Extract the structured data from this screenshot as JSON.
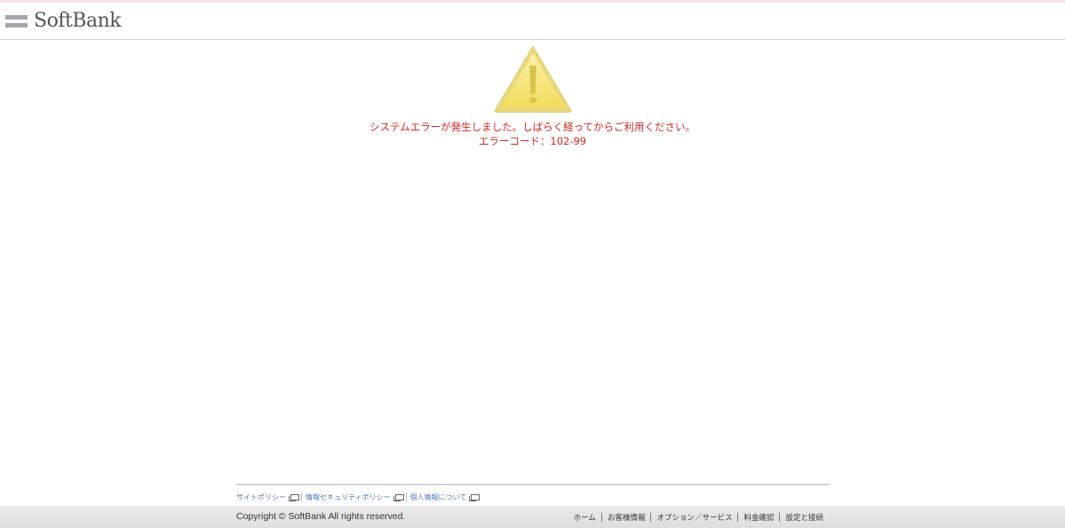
{
  "header": {
    "logo_text": "SoftBank"
  },
  "error": {
    "icon": "warning-triangle-icon",
    "message": "システムエラーが発生しました。しばらく経ってからご利用ください。",
    "code_line": "エラーコード：102-99"
  },
  "footer": {
    "policy_links": [
      {
        "label": "サイトポリシー"
      },
      {
        "label": "情報セキュリティポリシー"
      },
      {
        "label": "個人情報について"
      }
    ],
    "copyright": "Copyright © SoftBank All rights reserved.",
    "nav": [
      {
        "label": "ホーム"
      },
      {
        "label": "お客様情報"
      },
      {
        "label": "オプション／サービス"
      },
      {
        "label": "料金確認"
      },
      {
        "label": "設定と接続"
      }
    ]
  },
  "colors": {
    "error_text": "#d32b22",
    "link": "#4a7fb8",
    "warning_fill": "#f4df6a",
    "warning_border": "#e7d36a"
  }
}
